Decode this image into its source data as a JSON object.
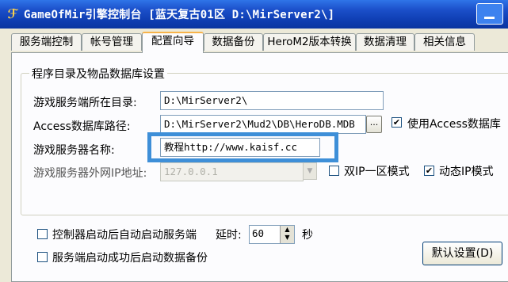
{
  "window": {
    "title": "GameOfMir引擎控制台 [蓝天复古01区 D:\\MirServer2\\]"
  },
  "tabs": [
    {
      "label": "服务端控制"
    },
    {
      "label": "帐号管理"
    },
    {
      "label": "配置向导"
    },
    {
      "label": "数据备份"
    },
    {
      "label": "HeroM2版本转换"
    },
    {
      "label": "数据清理"
    },
    {
      "label": "相关信息"
    }
  ],
  "active_tab": "配置向导",
  "group": {
    "title": "程序目录及物品数据库设置"
  },
  "fields": {
    "server_dir": {
      "label": "游戏服务端所在目录:",
      "value": "D:\\MirServer2\\"
    },
    "access_db": {
      "label": "Access数据库路径:",
      "value": "D:\\MirServer2\\Mud2\\DB\\HeroDB.MDB",
      "browse": "..."
    },
    "server_name": {
      "label": "游戏服务器名称:",
      "value": "教程http://www.kaisf.cc"
    },
    "external_ip": {
      "label": "游戏服务器外网IP地址:",
      "value": "127.0.0.1"
    }
  },
  "checkboxes": {
    "use_access": {
      "label": "使用Access数据库",
      "checked": true
    },
    "dual_ip": {
      "label": "双IP一区模式",
      "checked": false
    },
    "dynamic_ip": {
      "label": "动态IP模式",
      "checked": true
    },
    "autostart": {
      "label": "控制器启动后自动启动服务端",
      "checked": false
    },
    "backup": {
      "label": "服务端启动成功后启动数据备份",
      "checked": false
    }
  },
  "delay": {
    "label": "延时:",
    "value": "60",
    "unit": "秒"
  },
  "buttons": {
    "default_settings": "默认设置(D)"
  },
  "colors": {
    "highlight": "#3e8fd8",
    "titlebar": "#0a35a0",
    "active_tab_accent": "#f7b34a"
  }
}
